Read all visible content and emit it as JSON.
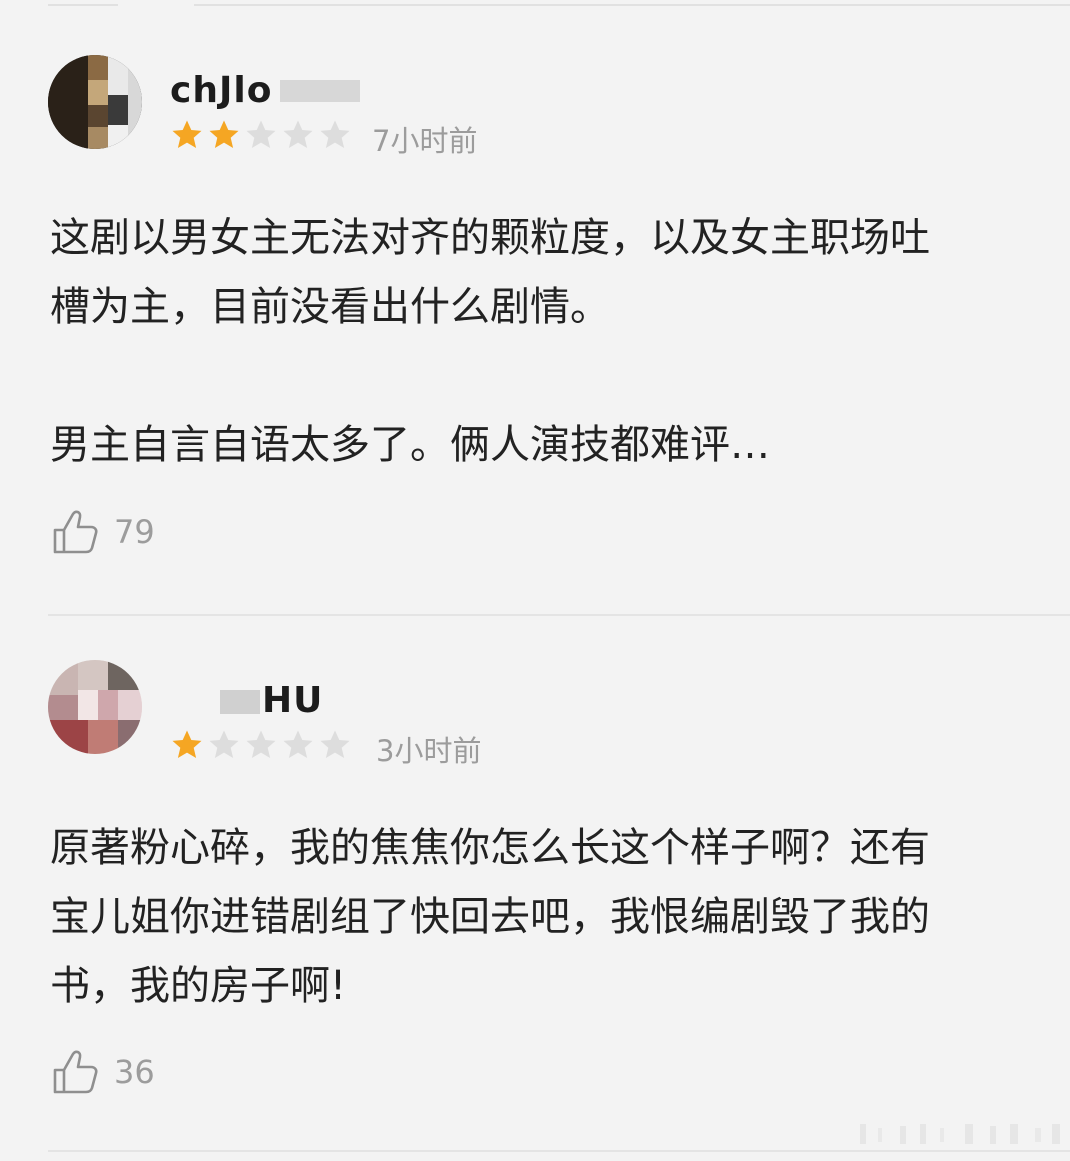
{
  "reviews": [
    {
      "username": "chJlo",
      "rating": 2,
      "max_rating": 5,
      "time": "7小时前",
      "body_lines": [
        "这剧以男女主无法对齐的颗粒度，以及女主职场吐",
        "槽为主，目前没看出什么剧情。",
        "",
        "男主自言自语太多了。俩人演技都难评…"
      ],
      "likes": "79"
    },
    {
      "username": "HU",
      "rating": 1,
      "max_rating": 5,
      "time": "3小时前",
      "body_lines": [
        "原著粉心碎，我的焦焦你怎么长这个样子啊？还有",
        "宝儿姐你进错剧组了快回去吧，我恨编剧毁了我的",
        "书，我的房子啊!"
      ],
      "likes": "36"
    }
  ],
  "icons": {
    "star": "star-icon",
    "like": "thumbs-up-icon"
  },
  "colors": {
    "star_active": "#f5a623",
    "star_inactive": "#dddddd",
    "meta_text": "#9c9c9c",
    "body_text": "#222222"
  }
}
